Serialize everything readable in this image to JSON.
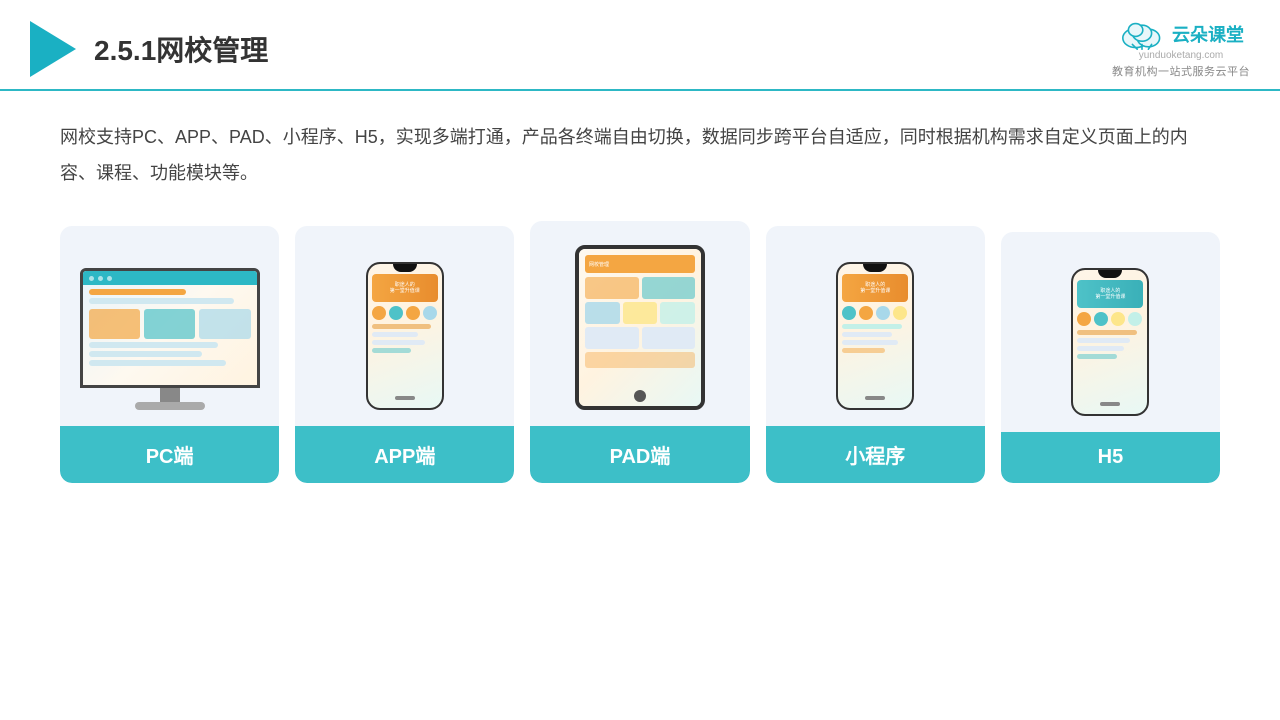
{
  "header": {
    "title": "2.5.1网校管理",
    "brand": {
      "name": "云朵课堂",
      "url": "yunduoketang.com",
      "subtitle": "教育机构一站\n式服务云平台"
    }
  },
  "description": "网校支持PC、APP、PAD、小程序、H5，实现多端打通，产品各终端自由切换，数据同步跨平台自适应，同时根据机构需求自定义页面上的内容、课程、功能模块等。",
  "cards": [
    {
      "label": "PC端",
      "type": "pc"
    },
    {
      "label": "APP端",
      "type": "phone"
    },
    {
      "label": "PAD端",
      "type": "tablet"
    },
    {
      "label": "小程序",
      "type": "phone2"
    },
    {
      "label": "H5",
      "type": "phone3"
    }
  ]
}
